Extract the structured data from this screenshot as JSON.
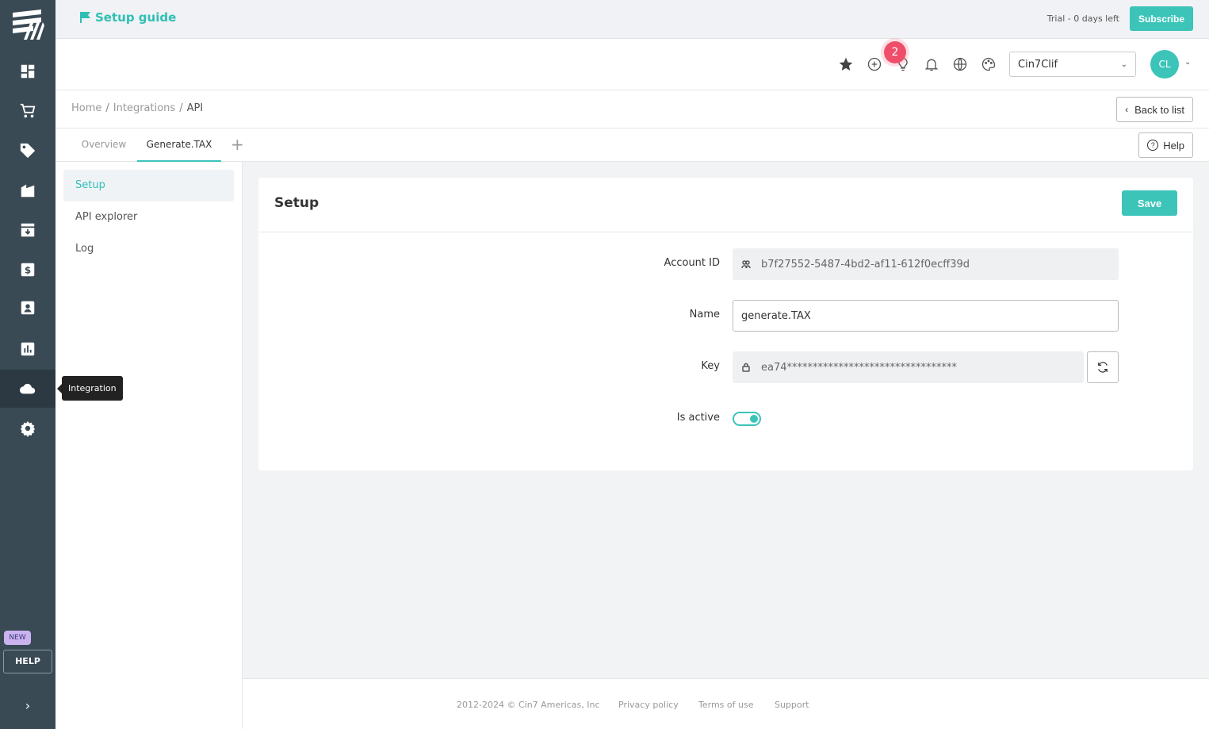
{
  "topbar": {
    "setup_guide": "Setup guide",
    "trial_text": "Trial - 0 days left",
    "subscribe_label": "Subscribe"
  },
  "header": {
    "notification_count": "2",
    "company": "Cin7Clif",
    "avatar_initials": "CL"
  },
  "breadcrumb": {
    "items": [
      "Home",
      "Integrations",
      "API"
    ],
    "back_label": "Back to list"
  },
  "tabs": {
    "items": [
      "Overview",
      "Generate.TAX"
    ],
    "active": "Generate.TAX",
    "help_label": "Help"
  },
  "sidenav": {
    "items": [
      "Setup",
      "API explorer",
      "Log"
    ],
    "active": "Setup"
  },
  "rail": {
    "tooltip": "Integration",
    "new_badge": "NEW",
    "help_label": "HELP"
  },
  "setup": {
    "title": "Setup",
    "save_label": "Save",
    "account_id_label": "Account ID",
    "account_id_value": "b7f27552-5487-4bd2-af11-612f0ecff39d",
    "name_label": "Name",
    "name_value": "generate.TAX",
    "key_label": "Key",
    "key_value": "ea74*********************************",
    "is_active_label": "Is active",
    "is_active": true
  },
  "footer": {
    "copyright": "2012-2024 © Cin7 Americas, Inc",
    "privacy": "Privacy policy",
    "terms": "Terms of use",
    "support": "Support"
  },
  "colors": {
    "accent": "#3cc4b9",
    "rail": "#3a4a55",
    "badge": "#ef4e6a"
  }
}
